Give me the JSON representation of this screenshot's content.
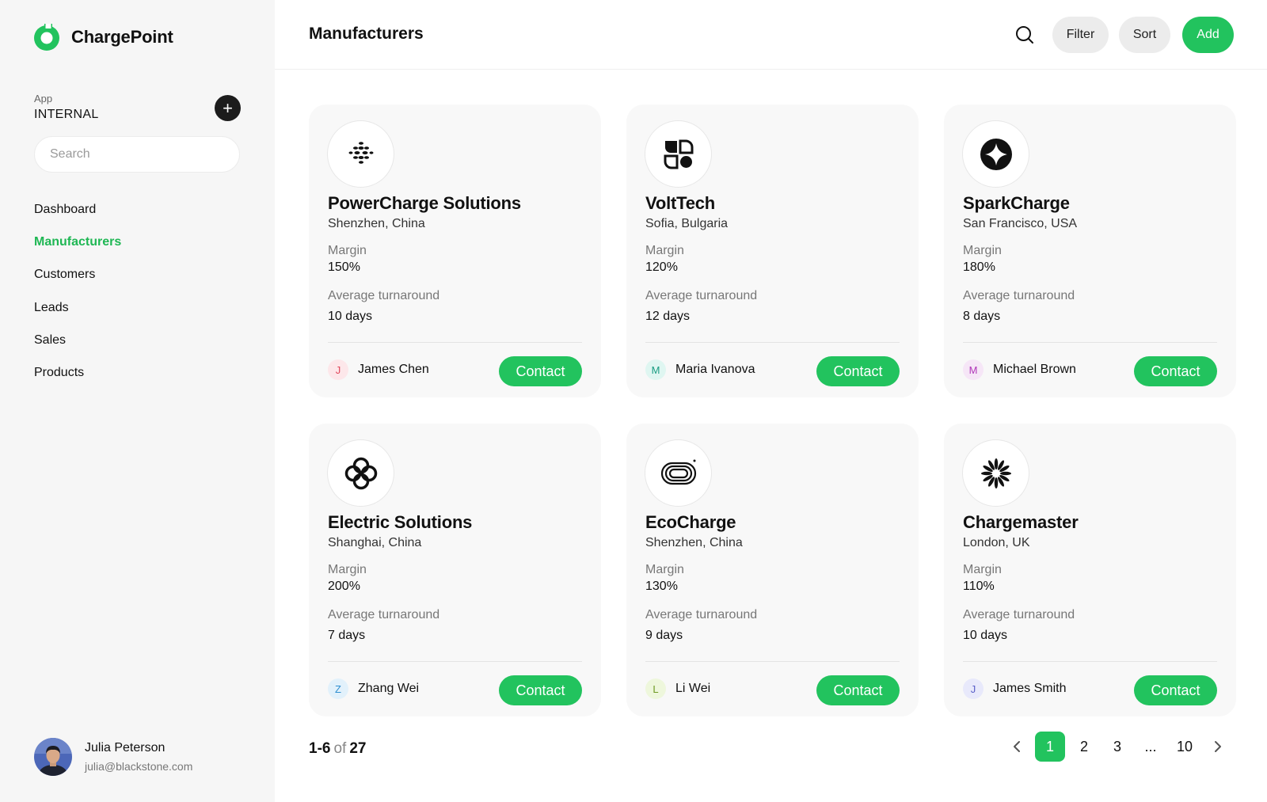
{
  "brand": {
    "name": "ChargePoint",
    "color": "#22c35e"
  },
  "sidebar": {
    "app_label": "App",
    "app_value": "INTERNAL",
    "add_icon": "plus-icon",
    "search_placeholder": "Search",
    "nav": [
      {
        "label": "Dashboard",
        "active": false
      },
      {
        "label": "Manufacturers",
        "active": true
      },
      {
        "label": "Customers",
        "active": false
      },
      {
        "label": "Leads",
        "active": false
      },
      {
        "label": "Sales",
        "active": false
      },
      {
        "label": "Products",
        "active": false
      }
    ],
    "user": {
      "name": "Julia Peterson",
      "email": "julia@blackstone.com"
    }
  },
  "header": {
    "title": "Manufacturers",
    "search_icon": "search-icon",
    "filter_label": "Filter",
    "sort_label": "Sort",
    "add_label": "Add"
  },
  "cards": [
    {
      "name": "PowerCharge Solutions",
      "location": "Shenzhen, China",
      "margin_label": "Margin",
      "margin": "150%",
      "turnaround_label": "Average turnaround",
      "turnaround": "10 days",
      "contact_initial": "J",
      "contact_name": "James Chen",
      "contact_label": "Contact",
      "logo_icon": "dots-pattern-icon",
      "initial_bg": "#fde7ea",
      "initial_color": "#e0465a"
    },
    {
      "name": "VoltTech",
      "location": "Sofia, Bulgaria",
      "margin_label": "Margin",
      "margin": "120%",
      "turnaround_label": "Average turnaround",
      "turnaround": "12 days",
      "contact_initial": "M",
      "contact_name": "Maria Ivanova",
      "contact_label": "Contact",
      "logo_icon": "geometric-blocks-icon",
      "initial_bg": "#dff6f1",
      "initial_color": "#1a9c82"
    },
    {
      "name": "SparkCharge",
      "location": "San Francisco, USA",
      "margin_label": "Margin",
      "margin": "180%",
      "turnaround_label": "Average turnaround",
      "turnaround": "8 days",
      "contact_initial": "M",
      "contact_name": "Michael Brown",
      "contact_label": "Contact",
      "logo_icon": "star-circle-icon",
      "initial_bg": "#f6e6f7",
      "initial_color": "#b036b8"
    },
    {
      "name": "Electric Solutions",
      "location": "Shanghai, China",
      "margin_label": "Margin",
      "margin": "200%",
      "turnaround_label": "Average turnaround",
      "turnaround": "7 days",
      "contact_initial": "Z",
      "contact_name": "Zhang Wei",
      "contact_label": "Contact",
      "logo_icon": "quatrefoil-icon",
      "initial_bg": "#e2f1fb",
      "initial_color": "#2f8fd0"
    },
    {
      "name": "EcoCharge",
      "location": "Shenzhen, China",
      "margin_label": "Margin",
      "margin": "130%",
      "turnaround_label": "Average turnaround",
      "turnaround": "9 days",
      "contact_initial": "L",
      "contact_name": "Li Wei",
      "contact_label": "Contact",
      "logo_icon": "concentric-loop-icon",
      "initial_bg": "#eef7dc",
      "initial_color": "#6f9a24"
    },
    {
      "name": "Chargemaster",
      "location": "London, UK",
      "margin_label": "Margin",
      "margin": "110%",
      "turnaround_label": "Average turnaround",
      "turnaround": "10 days",
      "contact_initial": "J",
      "contact_name": "James Smith",
      "contact_label": "Contact",
      "logo_icon": "burst-icon",
      "initial_bg": "#e8e9fb",
      "initial_color": "#5a5fc8"
    }
  ],
  "pagination": {
    "range": "1-6",
    "of": "of",
    "total": "27",
    "prev_icon": "chevron-left-icon",
    "next_icon": "chevron-right-icon",
    "pages": [
      "1",
      "2",
      "3",
      "...",
      "10"
    ],
    "current": "1"
  }
}
